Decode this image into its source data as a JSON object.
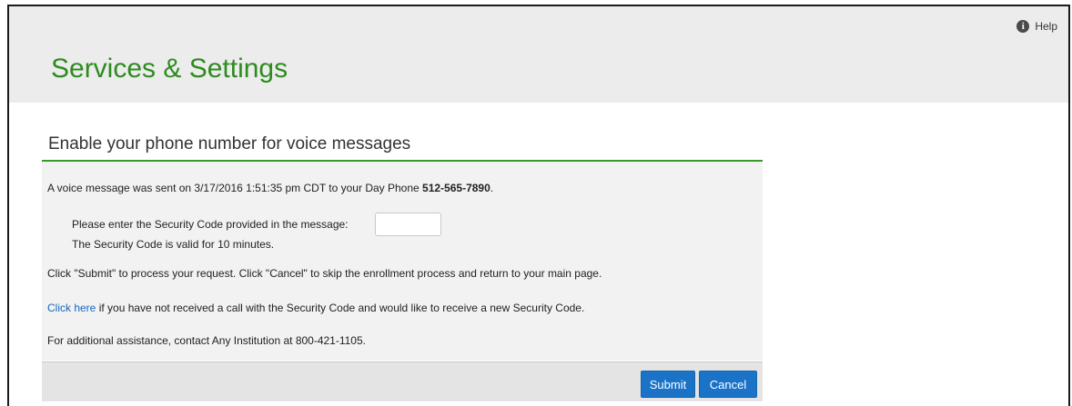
{
  "header": {
    "help_label": "Help",
    "title": "Services & Settings"
  },
  "section": {
    "title": "Enable your phone number for voice messages"
  },
  "message": {
    "sent_text": "A voice message was sent on 3/17/2016 1:51:35 pm CDT to your Day Phone ",
    "phone": "512-565-7890",
    "sent_suffix": ".",
    "enter_code_label": "Please enter the Security Code provided in the message:",
    "valid_note": "The Security Code is valid for 10 minutes.",
    "instructions": "Click \"Submit\" to process your request. Click \"Cancel\" to skip the enrollment process and return to your main page.",
    "resend_link": "Click here",
    "resend_text": " if you have not received a call with the Security Code and would like to receive a new Security Code.",
    "assistance": "For additional assistance, contact Any Institution at 800-421-1105."
  },
  "security_code": {
    "value": ""
  },
  "buttons": {
    "submit": "Submit",
    "cancel": "Cancel"
  },
  "colors": {
    "title_green": "#2e8b1e",
    "accent_green": "#3a9a2a",
    "button_blue": "#1a73c7",
    "link_blue": "#1565c0"
  },
  "icons": {
    "help": "info-circle-icon"
  }
}
